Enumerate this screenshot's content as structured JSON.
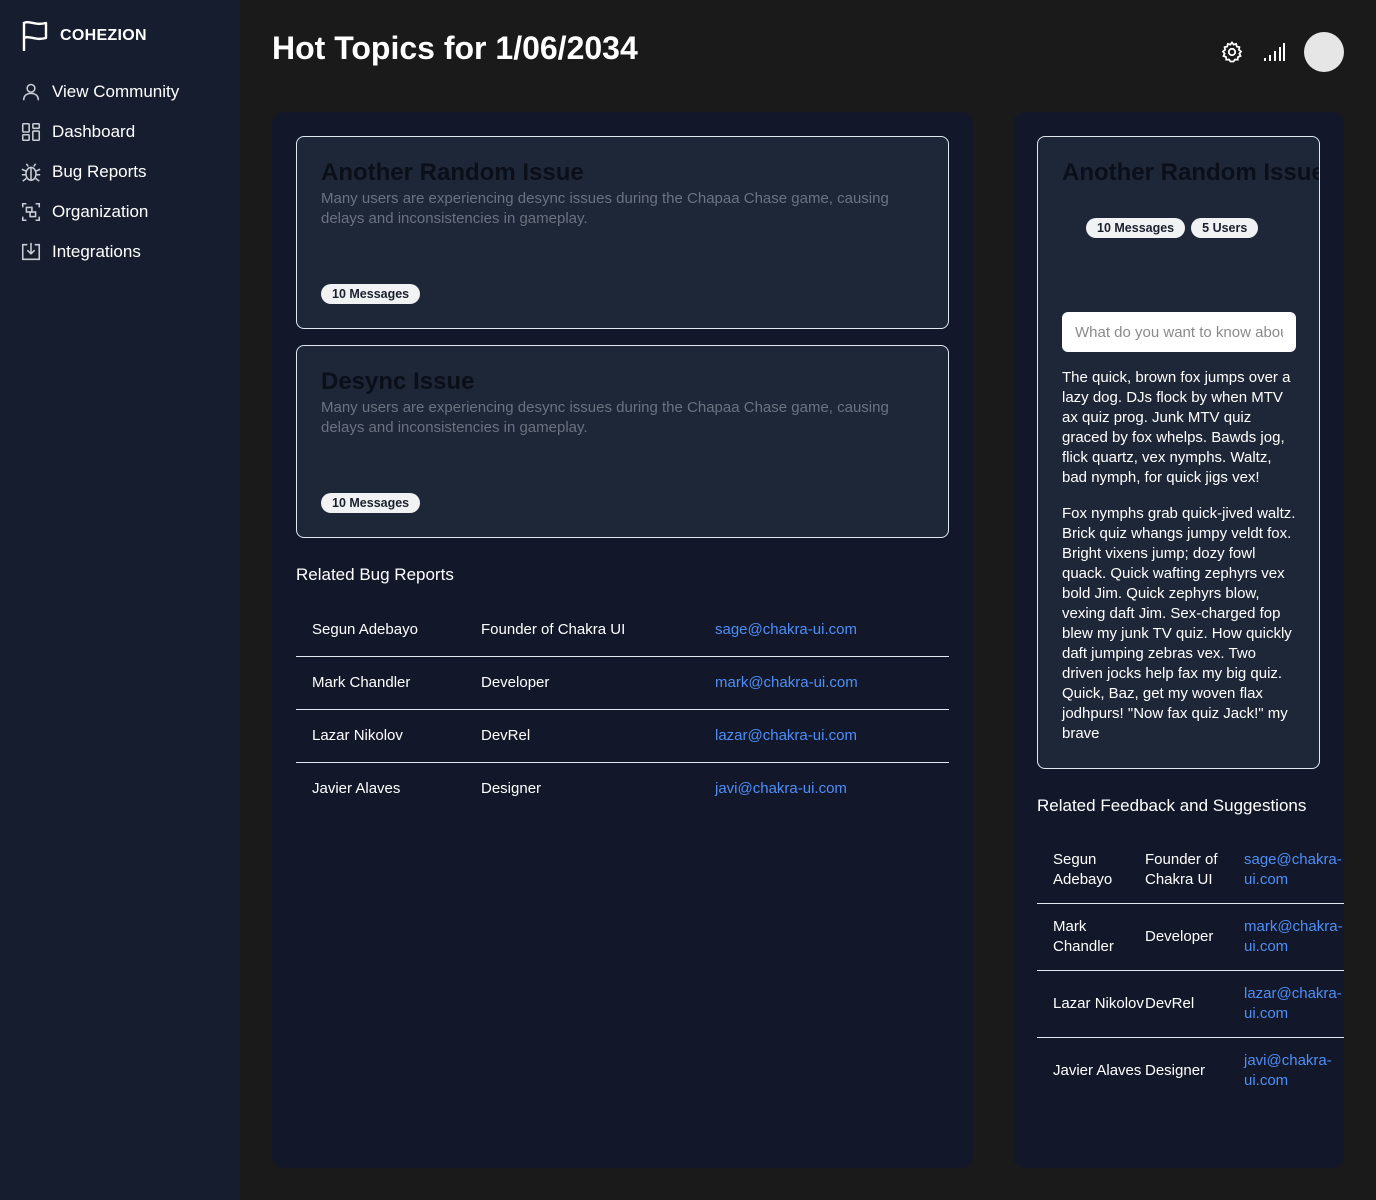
{
  "app": {
    "brand": "COHEZION"
  },
  "sidebar": {
    "items": [
      {
        "label": "View Community",
        "icon": "user-icon"
      },
      {
        "label": "Dashboard",
        "icon": "dashboard-icon"
      },
      {
        "label": "Bug Reports",
        "icon": "bug-icon"
      },
      {
        "label": "Organization",
        "icon": "organization-icon"
      },
      {
        "label": "Integrations",
        "icon": "integrations-icon"
      }
    ]
  },
  "header": {
    "title": "Hot Topics for 1/06/2034",
    "icons": [
      "settings-icon",
      "signal-icon",
      "avatar"
    ]
  },
  "topics": [
    {
      "title": "Another Random Issue",
      "description": "Many users are experiencing desync issues during the Chapaa Chase game, causing delays and inconsistencies in gameplay.",
      "badge": "10 Messages"
    },
    {
      "title": "Desync Issue",
      "description": "Many users are experiencing desync issues during the Chapaa Chase game, causing delays and inconsistencies in gameplay.",
      "badge": "10 Messages"
    }
  ],
  "bug_reports": {
    "title": "Related Bug Reports",
    "rows": [
      {
        "name": "Segun Adebayo",
        "role": "Founder of Chakra UI",
        "email": "sage@chakra-ui.com"
      },
      {
        "name": "Mark Chandler",
        "role": "Developer",
        "email": "mark@chakra-ui.com"
      },
      {
        "name": "Lazar Nikolov",
        "role": "DevRel",
        "email": "lazar@chakra-ui.com"
      },
      {
        "name": "Javier Alaves",
        "role": "Designer",
        "email": "javi@chakra-ui.com"
      }
    ]
  },
  "detail": {
    "title": "Another Random Issue",
    "badges": [
      "10 Messages",
      "5 Users"
    ],
    "ask_placeholder": "What do you want to know about this topic?",
    "paragraphs": [
      "The quick, brown fox jumps over a lazy dog. DJs flock by when MTV ax quiz prog. Junk MTV quiz graced by fox whelps. Bawds jog, flick quartz, vex nymphs. Waltz, bad nymph, for quick jigs vex!",
      "Fox nymphs grab quick-jived waltz. Brick quiz whangs jumpy veldt fox. Bright vixens jump; dozy fowl quack. Quick wafting zephyrs vex bold Jim. Quick zephyrs blow, vexing daft Jim. Sex-charged fop blew my junk TV quiz. How quickly daft jumping zebras vex. Two driven jocks help fax my big quiz. Quick, Baz, get my woven flax jodhpurs! \"Now fax quiz Jack!\" my brave"
    ]
  },
  "feedback": {
    "title": "Related Feedback and Suggestions",
    "rows": [
      {
        "name": "Segun Adebayo",
        "role": "Founder of Chakra UI",
        "email": "sage@chakra-ui.com"
      },
      {
        "name": "Mark Chandler",
        "role": "Developer",
        "email": "mark@chakra-ui.com"
      },
      {
        "name": "Lazar Nikolov",
        "role": "DevRel",
        "email": "lazar@chakra-ui.com"
      },
      {
        "name": "Javier Alaves",
        "role": "Designer",
        "email": "javi@chakra-ui.com"
      }
    ]
  }
}
